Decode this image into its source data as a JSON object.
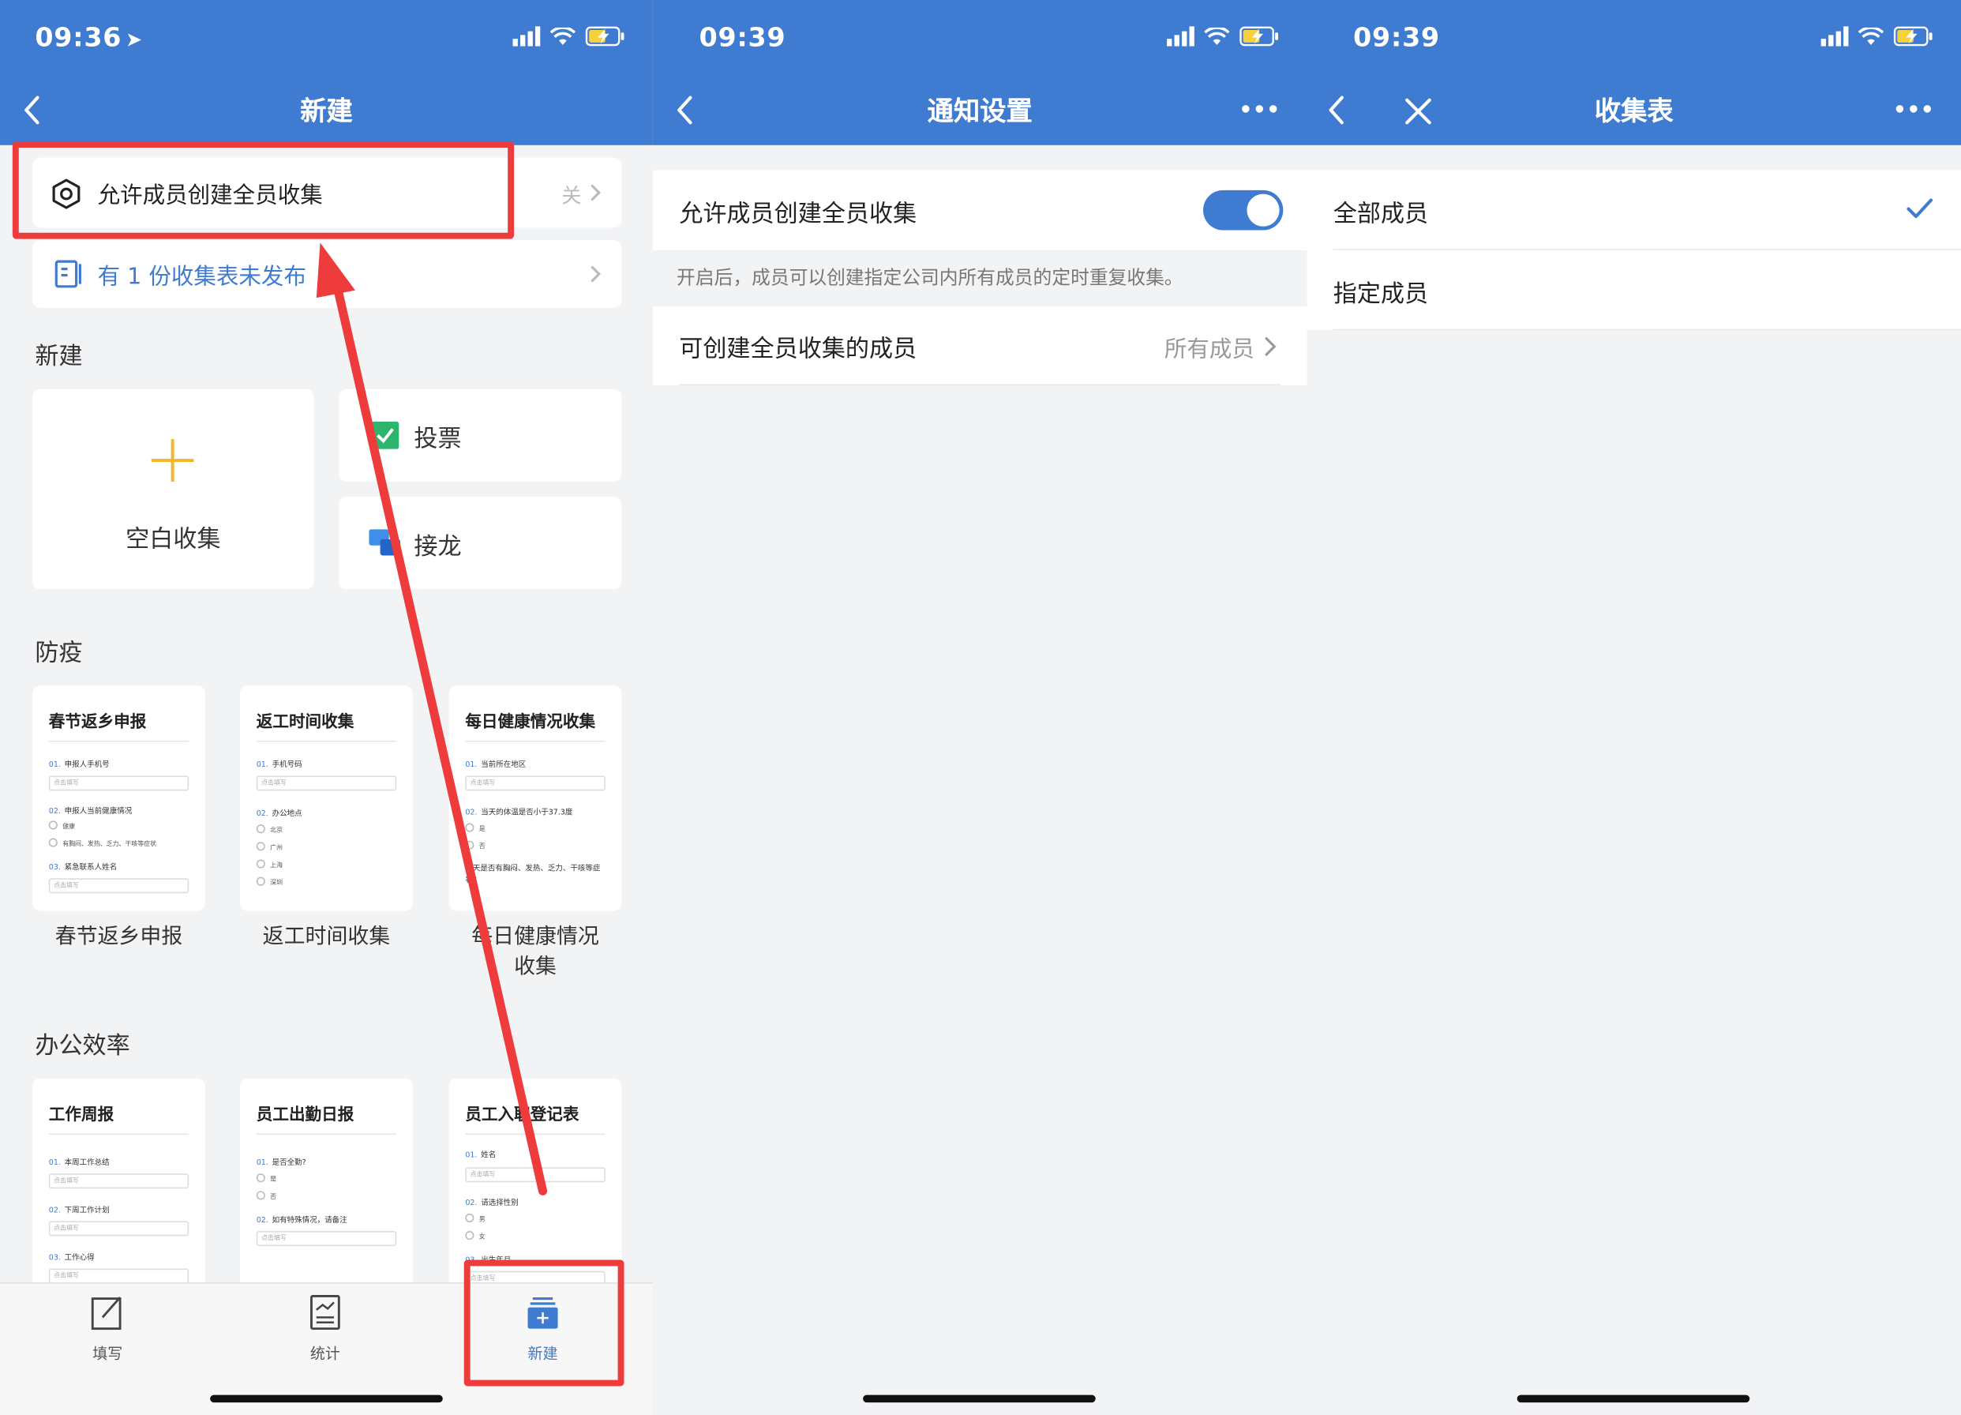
{
  "panels": [
    {
      "status_time": "09:36",
      "status_arrow": "➤",
      "title": "新建",
      "allow_row": {
        "label": "允许成员创建全员收集",
        "value": "关"
      },
      "unpublished_notice": "有 1 份收集表未发布",
      "sections": {
        "new": "新建",
        "epidemic": "防疫",
        "office": "办公效率"
      },
      "new_items": {
        "blank": "空白收集",
        "vote": "投票",
        "relay": "接龙"
      },
      "epidemic_templates": [
        {
          "title": "春节返乡申报",
          "caption": "春节返乡申报",
          "q1": "申报人手机号",
          "p1": "点击填写",
          "q2": "申报人当前健康情况",
          "o1": "健康",
          "o2": "有胸闷、发热、乏力、干咳等症状",
          "q3": "紧急联系人姓名",
          "p3": "点击填写"
        },
        {
          "title": "返工时间收集",
          "caption": "返工时间收集",
          "q1": "手机号码",
          "p1": "点击填写",
          "q2": "办公地点",
          "o1": "北京",
          "o2": "广州",
          "o3": "上海",
          "o4": "深圳"
        },
        {
          "title": "每日健康情况收集",
          "caption": "每日健康情况收集",
          "q1": "当前所在地区",
          "p1": "点击填写",
          "q2": "当天的体温是否小于37.3度",
          "o1": "是",
          "o2": "否",
          "q3": "当天是否有胸闷、发热、乏力、干咳等症状?"
        }
      ],
      "office_templates": [
        {
          "title": "工作周报",
          "q1": "本周工作总结",
          "p1": "点击填写",
          "q2": "下周工作计划",
          "p2": "点击填写",
          "q3": "工作心得",
          "p3": "点击填写"
        },
        {
          "title": "员工出勤日报",
          "q1": "是否全勤?",
          "o1": "是",
          "o2": "否",
          "q2": "如有特殊情况，请备注",
          "p2": "点击填写"
        },
        {
          "title": "员工入职登记表",
          "q1": "姓名",
          "p1": "点击填写",
          "q2": "请选择性别",
          "o1": "男",
          "o2": "女",
          "q3": "出生年月",
          "p3": "点击填写"
        }
      ],
      "q_numbers": [
        "01.",
        "02.",
        "03."
      ],
      "tabs": [
        {
          "label": "填写"
        },
        {
          "label": "统计"
        },
        {
          "label": "新建"
        }
      ]
    },
    {
      "status_time": "09:39",
      "title": "通知设置",
      "allow_label": "允许成员创建全员收集",
      "allow_enabled": true,
      "hint": "开启后，成员可以创建指定公司内所有成员的定时重复收集。",
      "members_label": "可创建全员收集的成员",
      "members_value": "所有成员"
    },
    {
      "status_time": "09:39",
      "title": "收集表",
      "options": [
        {
          "label": "全部成员",
          "selected": true
        },
        {
          "label": "指定成员",
          "selected": false
        }
      ]
    }
  ],
  "colors": {
    "header": "#3f7bd0",
    "accent": "#3f7bd0",
    "annotation": "#ee3b3b",
    "background": "#f2f3f5"
  }
}
